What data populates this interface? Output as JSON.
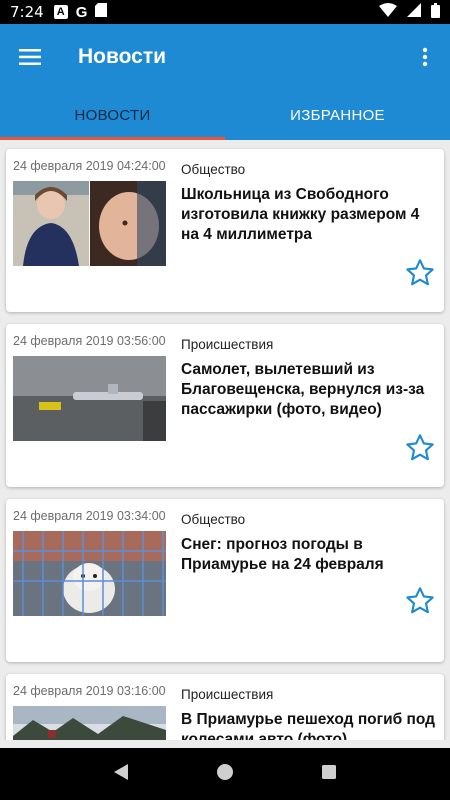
{
  "status_bar": {
    "time": "7:24",
    "icons": [
      "a-notification-icon",
      "google-icon",
      "sd-card-icon",
      "wifi-icon",
      "cell-signal-icon",
      "battery-icon"
    ]
  },
  "app_bar": {
    "title": "Новости",
    "menu_icon": "hamburger-menu-icon",
    "more_icon": "more-vert-icon"
  },
  "tabs": [
    {
      "label": "НОВОСТИ",
      "active": true
    },
    {
      "label": "ИЗБРАННОЕ",
      "active": false
    }
  ],
  "news": [
    {
      "date": "24 февраля 2019 04:24:00",
      "category": "Общество",
      "headline": "Школьница из Свободного изготовила книжку размером 4 на 4 миллиметра",
      "favorite": false
    },
    {
      "date": "24 февраля 2019 03:56:00",
      "category": "Происшествия",
      "headline": "Самолет, вылетевший из Благовещенска, вернулся из-за пассажирки (фото, видео)",
      "favorite": false
    },
    {
      "date": "24 февраля 2019 03:34:00",
      "category": "Общество",
      "headline": "Снег: прогноз погоды в Приамурье на 24 февраля",
      "favorite": false
    },
    {
      "date": "24 февраля 2019 03:16:00",
      "category": "Происшествия",
      "headline": "В Приамурье пешеход погиб под колесами авто (фото)",
      "favorite": false
    }
  ],
  "colors": {
    "primary": "#1f8ad4",
    "tab_indicator": "#e8543c",
    "star": "#1f8ad4"
  },
  "nav_bar": [
    "back-icon",
    "home-icon",
    "recents-icon"
  ]
}
